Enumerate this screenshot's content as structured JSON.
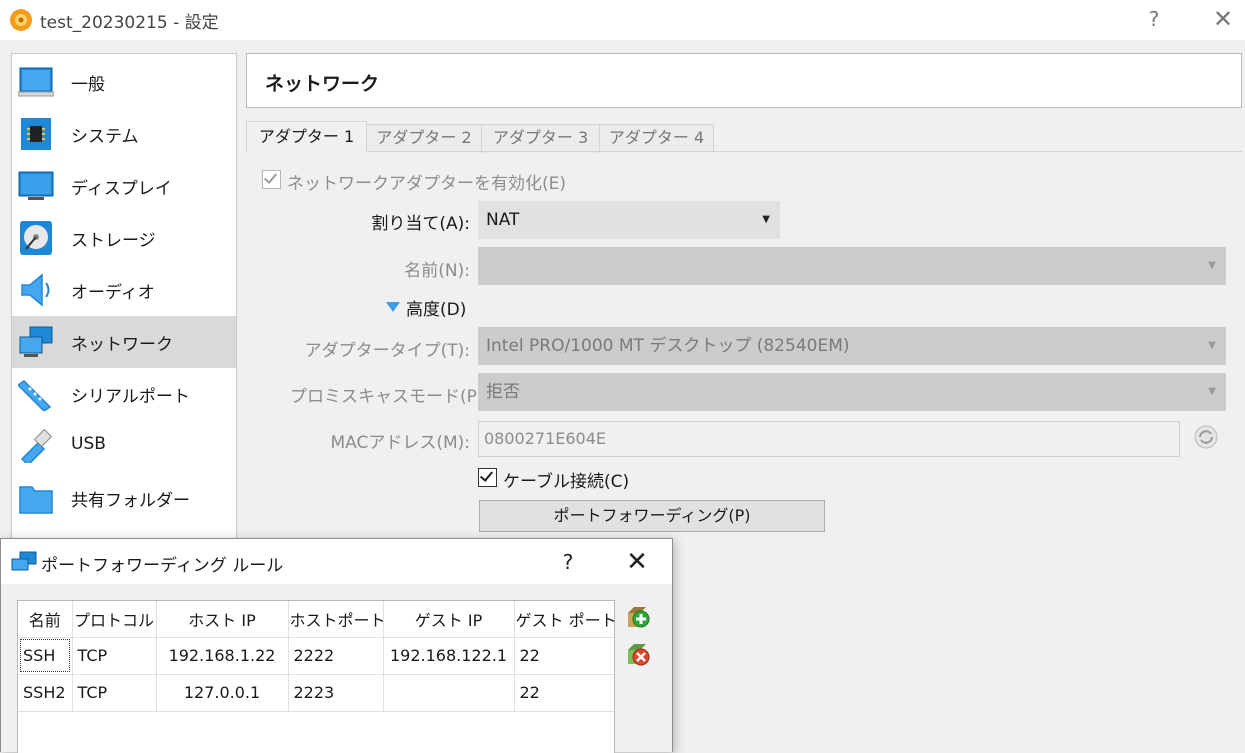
{
  "window": {
    "title": "test_20230215 - 設定",
    "help_glyph": "?",
    "close_glyph": "✕"
  },
  "sidebar": {
    "items": [
      {
        "label": "一般",
        "icon": "general-icon"
      },
      {
        "label": "システム",
        "icon": "system-chip-icon"
      },
      {
        "label": "ディスプレイ",
        "icon": "display-monitor-icon"
      },
      {
        "label": "ストレージ",
        "icon": "storage-disk-icon"
      },
      {
        "label": "オーディオ",
        "icon": "audio-speaker-icon"
      },
      {
        "label": "ネットワーク",
        "icon": "network-icon",
        "selected": true
      },
      {
        "label": "シリアルポート",
        "icon": "serial-port-icon"
      },
      {
        "label": "USB",
        "icon": "usb-icon"
      },
      {
        "label": "共有フォルダー",
        "icon": "shared-folder-icon"
      }
    ]
  },
  "section": {
    "title": "ネットワーク"
  },
  "tabs": [
    {
      "label": "アダプター 1",
      "active": true
    },
    {
      "label": "アダプター 2"
    },
    {
      "label": "アダプター 3"
    },
    {
      "label": "アダプター 4"
    }
  ],
  "adapter": {
    "enable_label": "ネットワークアダプターを有効化(E)",
    "enable_checked": true,
    "attached_label": "割り当て(A):",
    "attached_value": "NAT",
    "name_label": "名前(N):",
    "name_value": "",
    "advanced_label": "高度(D)",
    "adapter_type_label": "アダプタータイプ(T):",
    "adapter_type_value": "Intel PRO/1000 MT デスクトップ (82540EM)",
    "promisc_label": "プロミスキャスモード(P):",
    "promisc_value": "拒否",
    "mac_label": "MACアドレス(M):",
    "mac_value": "0800271E604E",
    "cable_label": "ケーブル接続(C)",
    "cable_checked": true,
    "port_forward_button": "ポートフォワーディング(P)"
  },
  "dialog": {
    "title": "ポートフォワーディング ルール",
    "help_glyph": "?",
    "close_glyph": "✕",
    "columns": [
      "名前",
      "プロトコル",
      "ホスト IP",
      "ホストポート",
      "ゲスト IP",
      "ゲスト ポート"
    ],
    "rows": [
      [
        "SSH",
        "TCP",
        "192.168.1.22",
        "2222",
        "192.168.122.1",
        "22"
      ],
      [
        "SSH2",
        "TCP",
        "127.0.0.1",
        "2223",
        "",
        "22"
      ]
    ],
    "add_icon": "add-rule-icon",
    "remove_icon": "remove-rule-icon"
  },
  "colors": {
    "accent_blue": "#1e88d6",
    "selection_gray": "#d9d9d9",
    "disabled_field": "#cccccc"
  }
}
